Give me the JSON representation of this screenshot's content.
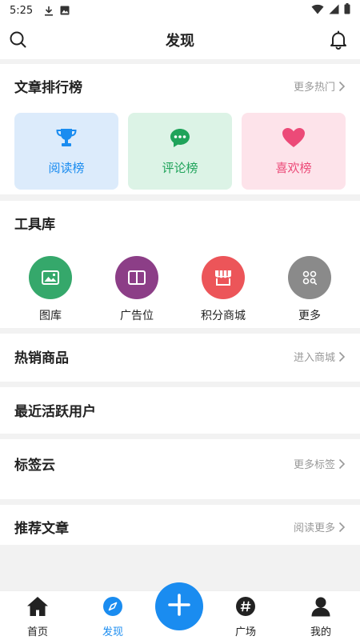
{
  "status_bar": {
    "time": "5:25",
    "icons": [
      "download-icon",
      "image-icon",
      "wifi-icon",
      "signal-icon",
      "battery-icon"
    ]
  },
  "header": {
    "title": "发现",
    "left_icon": "search-icon",
    "right_icon": "bell-icon"
  },
  "ranking": {
    "title": "文章排行榜",
    "more": "更多热门",
    "cards": [
      {
        "label": "阅读榜",
        "icon": "trophy-icon",
        "bg": "#dcebfb",
        "color": "#1a8cf0"
      },
      {
        "label": "评论榜",
        "icon": "chat-bubble-icon",
        "bg": "#dcf3e6",
        "color": "#1fa35a"
      },
      {
        "label": "喜欢榜",
        "icon": "heart-icon",
        "bg": "#fde3ea",
        "color": "#ec4a78"
      }
    ]
  },
  "tools": {
    "title": "工具库",
    "items": [
      {
        "label": "图库",
        "icon": "gallery-icon",
        "color": "#35a86b"
      },
      {
        "label": "广告位",
        "icon": "book-icon",
        "color": "#8c3e87"
      },
      {
        "label": "积分商城",
        "icon": "store-icon",
        "color": "#ec5559"
      },
      {
        "label": "更多",
        "icon": "more-grid-icon",
        "color": "#8a8a8a"
      }
    ]
  },
  "hot_goods": {
    "title": "热销商品",
    "more": "进入商城"
  },
  "active_users": {
    "title": "最近活跃用户"
  },
  "tag_cloud": {
    "title": "标签云",
    "more": "更多标签"
  },
  "recommended": {
    "title": "推荐文章",
    "more": "阅读更多"
  },
  "bottom_nav": {
    "items": [
      {
        "label": "首页",
        "icon": "home-icon"
      },
      {
        "label": "发现",
        "icon": "compass-icon",
        "active": true
      },
      {
        "label": "广场",
        "icon": "hashtag-icon"
      },
      {
        "label": "我的",
        "icon": "user-icon"
      }
    ],
    "fab_icon": "plus-icon",
    "active_color": "#1a8cf0"
  }
}
